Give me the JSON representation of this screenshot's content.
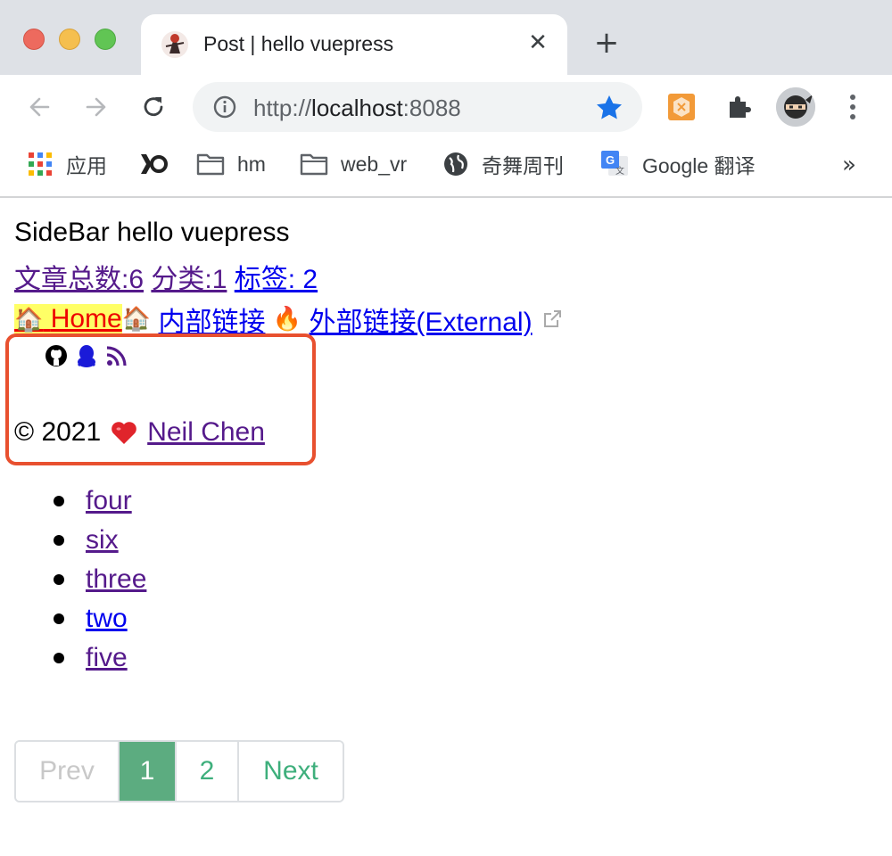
{
  "browser": {
    "tab_title": "Post | hello vuepress",
    "url_scheme": "http://",
    "url_host": "localhost",
    "url_port": ":8088",
    "bookmarks": [
      {
        "label": "应用",
        "icon": "apps-grid-icon"
      },
      {
        "label": "",
        "icon": "k-logo-icon"
      },
      {
        "label": "hm",
        "icon": "folder-icon"
      },
      {
        "label": "web_vr",
        "icon": "folder-icon"
      },
      {
        "label": "奇舞周刊",
        "icon": "globe-icon"
      },
      {
        "label": "Google 翻译",
        "icon": "google-translate-icon"
      }
    ],
    "more_bookmarks": "»"
  },
  "page": {
    "sidebar_title": "SideBar hello vuepress",
    "stats": {
      "articles": "文章总数:6",
      "categories": "分类:1",
      "tags": "标签: 2"
    },
    "nav": {
      "home_emoji": "🏠",
      "home_label": "Home",
      "internal_emoji": "🏠",
      "internal_label": "内部链接",
      "external_emoji": "🔥",
      "external_label": "外部链接(External)"
    },
    "social_icons": [
      "github-icon",
      "qq-icon",
      "rss-icon"
    ],
    "footer": {
      "copyright": "© 2021",
      "heart": "❤",
      "author": "Neil Chen"
    },
    "posts": [
      "four",
      "six",
      "three",
      "two",
      "five"
    ],
    "pagination": {
      "prev": "Prev",
      "pages": [
        "1",
        "2"
      ],
      "current": "1",
      "next": "Next"
    }
  },
  "colors": {
    "accent": "#3eaf7c",
    "active_page": "#5cac80",
    "highlight_border": "#e8502f",
    "home_highlight": "#ffff66"
  }
}
